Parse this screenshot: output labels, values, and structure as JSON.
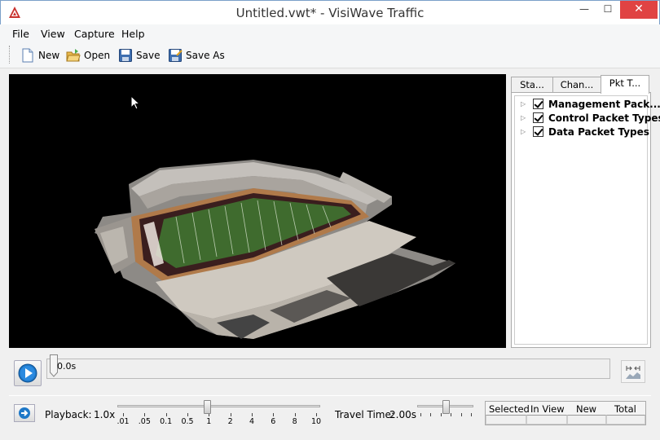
{
  "window": {
    "title": "Untitled.vwt* - VisiWave Traffic",
    "minimize": "—",
    "maximize": "☐",
    "close": "✕"
  },
  "menu": {
    "file": "File",
    "view": "View",
    "capture": "Capture",
    "help": "Help"
  },
  "toolbar": {
    "new_label": "New",
    "open_label": "Open",
    "save_label": "Save",
    "save_as_label": "Save As"
  },
  "panel": {
    "tabs": [
      "Sta...",
      "Chan...",
      "Pkt T..."
    ],
    "active_tab": "Pkt T...",
    "tree": [
      {
        "label": "Management Pack...",
        "checked": true
      },
      {
        "label": "Control Packet Types",
        "checked": true
      },
      {
        "label": "Data Packet Types",
        "checked": true
      }
    ]
  },
  "timeline": {
    "time": "0.0s"
  },
  "playback": {
    "label": "Playback:",
    "value": "1.0x",
    "ticks": [
      ".01",
      ".05",
      "0.1",
      "0.5",
      "1",
      "2",
      "4",
      "6",
      "8",
      "10"
    ],
    "selected_tick": "1"
  },
  "travel": {
    "label": "Travel Time:",
    "value": "2.00s",
    "level": 0.5
  },
  "stats": {
    "headers": [
      "Selected",
      "In View",
      "New",
      "Total"
    ]
  },
  "colors": {
    "close_button": "#e04343",
    "viewport_bg": "#000000",
    "field_green": "#3f6b2e",
    "accent_blue": "#1e78c8"
  }
}
